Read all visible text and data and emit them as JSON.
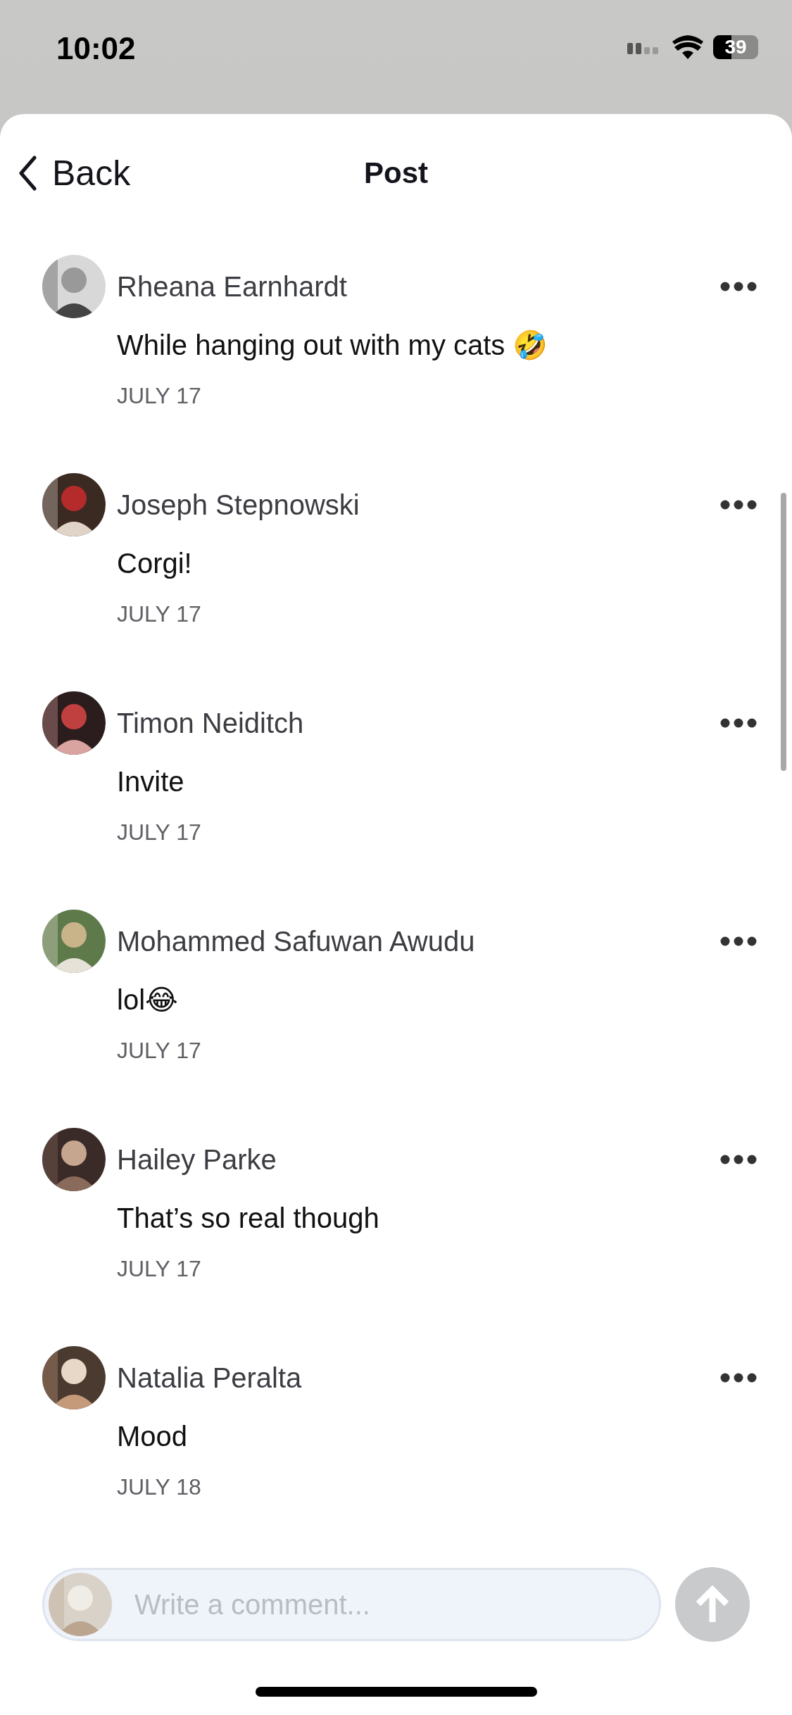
{
  "status_bar": {
    "time": "10:02",
    "battery": "39"
  },
  "header": {
    "back": "Back",
    "title": "Post"
  },
  "comments": [
    {
      "author": "Rheana Earnhardt",
      "text": "While hanging out with my cats 🤣",
      "date": "JULY 17"
    },
    {
      "author": "Joseph Stepnowski",
      "text": "Corgi!",
      "date": "JULY 17"
    },
    {
      "author": "Timon Neiditch",
      "text": "Invite",
      "date": "JULY 17"
    },
    {
      "author": "Mohammed Safuwan Awudu",
      "text": "lol😂",
      "date": "JULY 17"
    },
    {
      "author": "Hailey Parke",
      "text": "That’s so real though",
      "date": "JULY 17"
    },
    {
      "author": "Natalia Peralta",
      "text": "Mood",
      "date": "JULY 18"
    }
  ],
  "composer": {
    "placeholder": "Write a comment..."
  }
}
